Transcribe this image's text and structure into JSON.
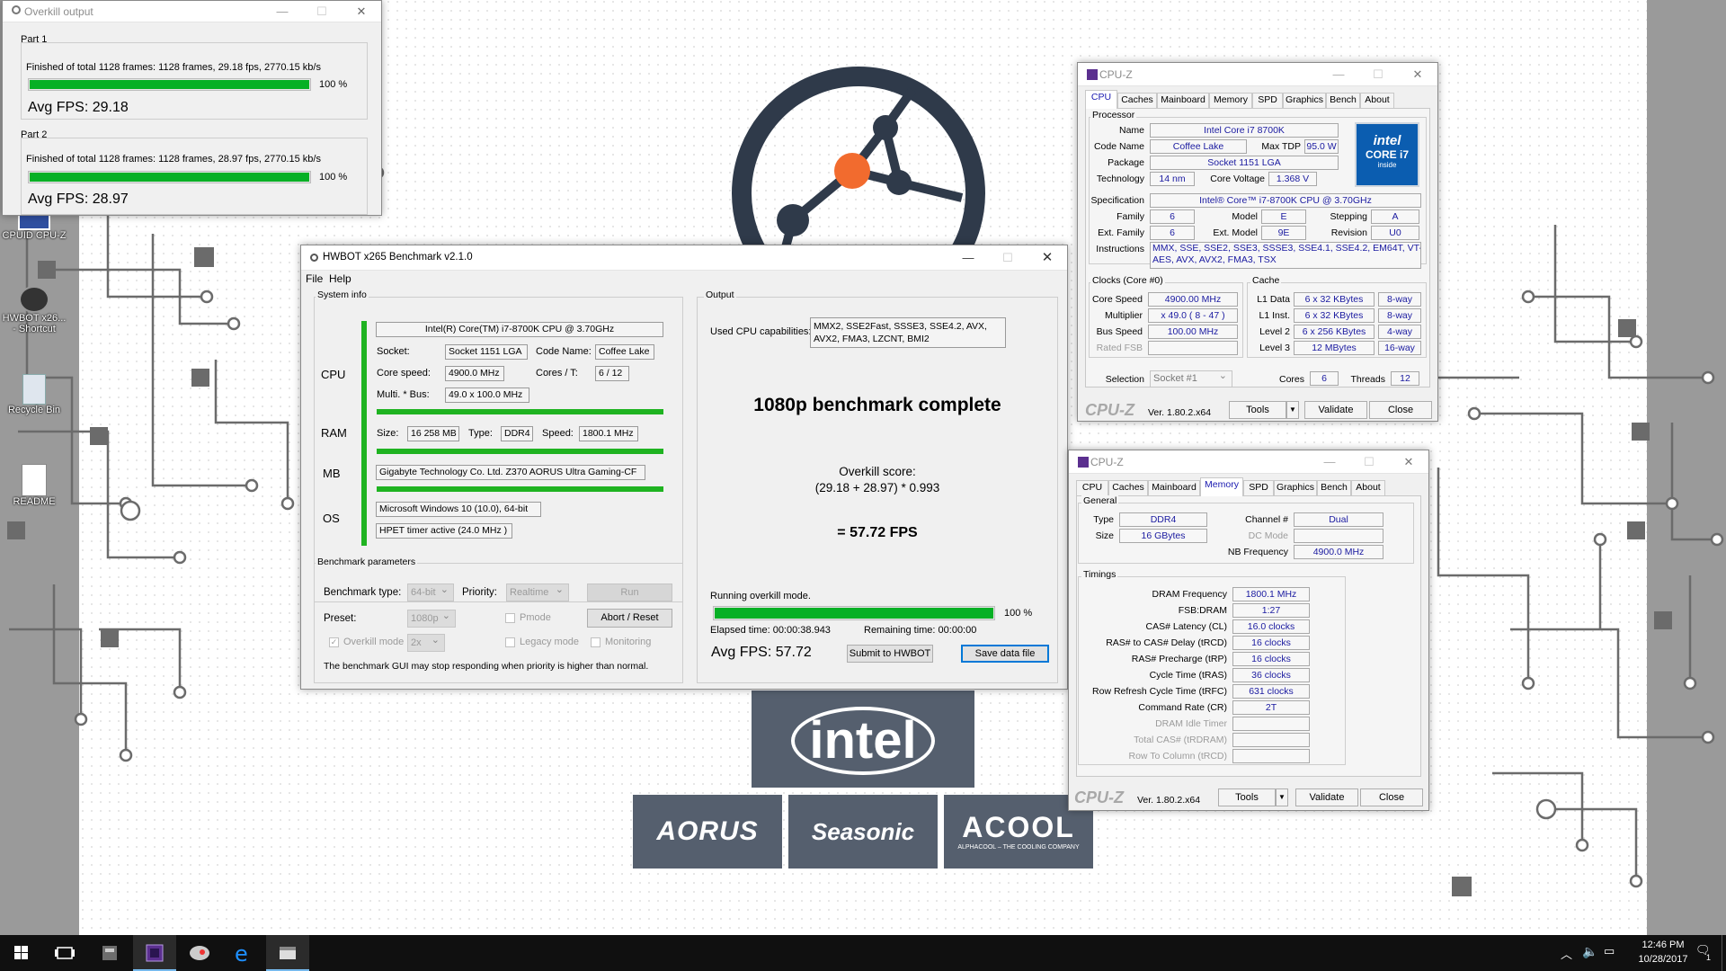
{
  "desktop": {
    "icons": [
      {
        "label": "CPUID CPU-Z",
        "icon": "cpuz-shortcut-icon"
      },
      {
        "label": "HWBOT x26... - Shortcut",
        "icon": "hwbot-shortcut-icon"
      },
      {
        "label": "Recycle Bin",
        "icon": "recycle-bin-icon"
      },
      {
        "label": "README",
        "icon": "text-file-icon"
      }
    ],
    "sponsors": {
      "intel": "intel",
      "aorus": "AORUS",
      "seasonic": "Seasonic",
      "alphacool": "ACOOL",
      "alphacool_tag": "ALPHACOOL – THE COOLING COMPANY"
    }
  },
  "overkill": {
    "title": "Overkill output",
    "parts": [
      {
        "label": "Part 1",
        "status": "Finished of total 1128 frames: 1128 frames, 29.18 fps,  2770.15 kb/s",
        "progress": 100,
        "percent": "100 %",
        "avg": "Avg FPS: 29.18"
      },
      {
        "label": "Part 2",
        "status": "Finished of total 1128 frames: 1128 frames, 28.97 fps,  2770.15 kb/s",
        "progress": 100,
        "percent": "100 %",
        "avg": "Avg FPS: 28.97"
      }
    ]
  },
  "hwbot": {
    "title": "HWBOT x265 Benchmark v2.1.0",
    "menu": {
      "file": "File",
      "help": "Help"
    },
    "sysinfo": {
      "group": "System info",
      "cpu_label": "CPU",
      "ram_label": "RAM",
      "mb_label": "MB",
      "os_label": "OS",
      "cpu_name": "Intel(R) Core(TM) i7-8700K CPU @ 3.70GHz",
      "socket_label": "Socket:",
      "socket": "Socket 1151 LGA",
      "codename_label": "Code Name:",
      "codename": "Coffee Lake",
      "corespeed_label": "Core speed:",
      "corespeed": "4900.0 MHz",
      "cores_label": "Cores / T:",
      "cores": "6 / 12",
      "multi_label": "Multi. * Bus:",
      "multi": "49.0 x 100.0 MHz",
      "size_label": "Size:",
      "size": "16 258 MB",
      "type_label": "Type:",
      "type": "DDR4",
      "speed_label": "Speed:",
      "speed": "1800.1 MHz",
      "mb": "Gigabyte Technology Co. Ltd. Z370 AORUS Ultra Gaming-CF",
      "os": "Microsoft Windows 10 (10.0), 64-bit",
      "timer": "HPET timer active (24.0 MHz )"
    },
    "params": {
      "group": "Benchmark parameters",
      "type_label": "Benchmark type:",
      "type": "64-bit",
      "priority_label": "Priority:",
      "priority": "Realtime",
      "run": "Run",
      "preset_label": "Preset:",
      "preset": "1080p",
      "pmode": "Pmode",
      "abort": "Abort / Reset",
      "overkill": "Overkill mode",
      "overkill_value": "2x",
      "legacy": "Legacy mode",
      "monitoring": "Monitoring",
      "note": "The benchmark GUI may stop responding when priority is higher than normal."
    },
    "output": {
      "group": "Output",
      "caps_label": "Used CPU capabilities:",
      "caps": "MMX2, SSE2Fast, SSSE3, SSE4.2, AVX, AVX2, FMA3, LZCNT, BMI2",
      "complete": "1080p benchmark complete",
      "score_label": "Overkill score:",
      "formula": "(29.18 + 28.97) * 0.993",
      "result": "= 57.72 FPS",
      "running": "Running overkill mode.",
      "progress": 100,
      "percent": "100 %",
      "elapsed": "Elapsed time: 00:00:38.943",
      "remaining": "Remaining time: 00:00:00",
      "avg": "Avg FPS: 57.72",
      "submit": "Submit to HWBOT",
      "save": "Save data file"
    }
  },
  "cpuz1": {
    "title": "CPU-Z",
    "tabs": [
      "CPU",
      "Caches",
      "Mainboard",
      "Memory",
      "SPD",
      "Graphics",
      "Bench",
      "About"
    ],
    "active_tab": "CPU",
    "processor": {
      "group": "Processor",
      "name_label": "Name",
      "name": "Intel Core i7 8700K",
      "codename_label": "Code Name",
      "codename": "Coffee Lake",
      "tdp_label": "Max TDP",
      "tdp": "95.0 W",
      "package_label": "Package",
      "package": "Socket 1151 LGA",
      "tech_label": "Technology",
      "tech": "14 nm",
      "voltage_label": "Core Voltage",
      "voltage": "1.368 V",
      "spec_label": "Specification",
      "spec": "Intel® Core™ i7-8700K CPU @ 3.70GHz",
      "family_label": "Family",
      "family": "6",
      "model_label": "Model",
      "model": "E",
      "stepping_label": "Stepping",
      "stepping": "A",
      "extfamily_label": "Ext. Family",
      "extfamily": "6",
      "extmodel_label": "Ext. Model",
      "extmodel": "9E",
      "revision_label": "Revision",
      "revision": "U0",
      "instr_label": "Instructions",
      "instr1": "MMX, SSE, SSE2, SSE3, SSSE3, SSE4.1, SSE4.2, EM64T, VT-x,",
      "instr2": "AES, AVX, AVX2, FMA3, TSX",
      "badge_brand": "intel",
      "badge_line": "CORE i7",
      "badge_sub": "inside"
    },
    "clocks": {
      "group": "Clocks (Core #0)",
      "corespeed_label": "Core Speed",
      "corespeed": "4900.00 MHz",
      "multi_label": "Multiplier",
      "multi": "x 49.0 ( 8 - 47 )",
      "bus_label": "Bus Speed",
      "bus": "100.00 MHz",
      "rated_label": "Rated FSB",
      "rated": ""
    },
    "cache": {
      "group": "Cache",
      "l1d_label": "L1 Data",
      "l1d": "6 x 32 KBytes",
      "l1d_way": "8-way",
      "l1i_label": "L1 Inst.",
      "l1i": "6 x 32 KBytes",
      "l1i_way": "8-way",
      "l2_label": "Level 2",
      "l2": "6 x 256 KBytes",
      "l2_way": "4-way",
      "l3_label": "Level 3",
      "l3": "12 MBytes",
      "l3_way": "16-way"
    },
    "bottom": {
      "selection_label": "Selection",
      "selection": "Socket #1",
      "cores_label": "Cores",
      "cores": "6",
      "threads_label": "Threads",
      "threads": "12"
    },
    "footer": {
      "logo": "CPU-Z",
      "version": "Ver. 1.80.2.x64",
      "tools": "Tools",
      "validate": "Validate",
      "close": "Close"
    }
  },
  "cpuz2": {
    "title": "CPU-Z",
    "tabs": [
      "CPU",
      "Caches",
      "Mainboard",
      "Memory",
      "SPD",
      "Graphics",
      "Bench",
      "About"
    ],
    "active_tab": "Memory",
    "general": {
      "group": "General",
      "type_label": "Type",
      "type": "DDR4",
      "size_label": "Size",
      "size": "16 GBytes",
      "channel_label": "Channel #",
      "channel": "Dual",
      "dcmode_label": "DC Mode",
      "dcmode": "",
      "nbfreq_label": "NB Frequency",
      "nbfreq": "4900.0 MHz"
    },
    "timings": {
      "group": "Timings",
      "rows": [
        {
          "label": "DRAM Frequency",
          "value": "1800.1 MHz",
          "dim": false
        },
        {
          "label": "FSB:DRAM",
          "value": "1:27",
          "dim": false
        },
        {
          "label": "CAS# Latency (CL)",
          "value": "16.0 clocks",
          "dim": false
        },
        {
          "label": "RAS# to CAS# Delay (tRCD)",
          "value": "16 clocks",
          "dim": false
        },
        {
          "label": "RAS# Precharge (tRP)",
          "value": "16 clocks",
          "dim": false
        },
        {
          "label": "Cycle Time (tRAS)",
          "value": "36 clocks",
          "dim": false
        },
        {
          "label": "Row Refresh Cycle Time (tRFC)",
          "value": "631 clocks",
          "dim": false
        },
        {
          "label": "Command Rate (CR)",
          "value": "2T",
          "dim": false
        },
        {
          "label": "DRAM Idle Timer",
          "value": "",
          "dim": true
        },
        {
          "label": "Total CAS# (tRDRAM)",
          "value": "",
          "dim": true
        },
        {
          "label": "Row To Column (tRCD)",
          "value": "",
          "dim": true
        }
      ]
    },
    "footer": {
      "logo": "CPU-Z",
      "version": "Ver. 1.80.2.x64",
      "tools": "Tools",
      "validate": "Validate",
      "close": "Close"
    }
  },
  "taskbar": {
    "time": "12:46 PM",
    "date": "10/28/2017",
    "notification_count": "1"
  },
  "colors": {
    "progress_green": "#06b025",
    "bar_green": "#1fb321",
    "taskbar": "#101010",
    "cpuz_value": "#1a1aa0"
  }
}
